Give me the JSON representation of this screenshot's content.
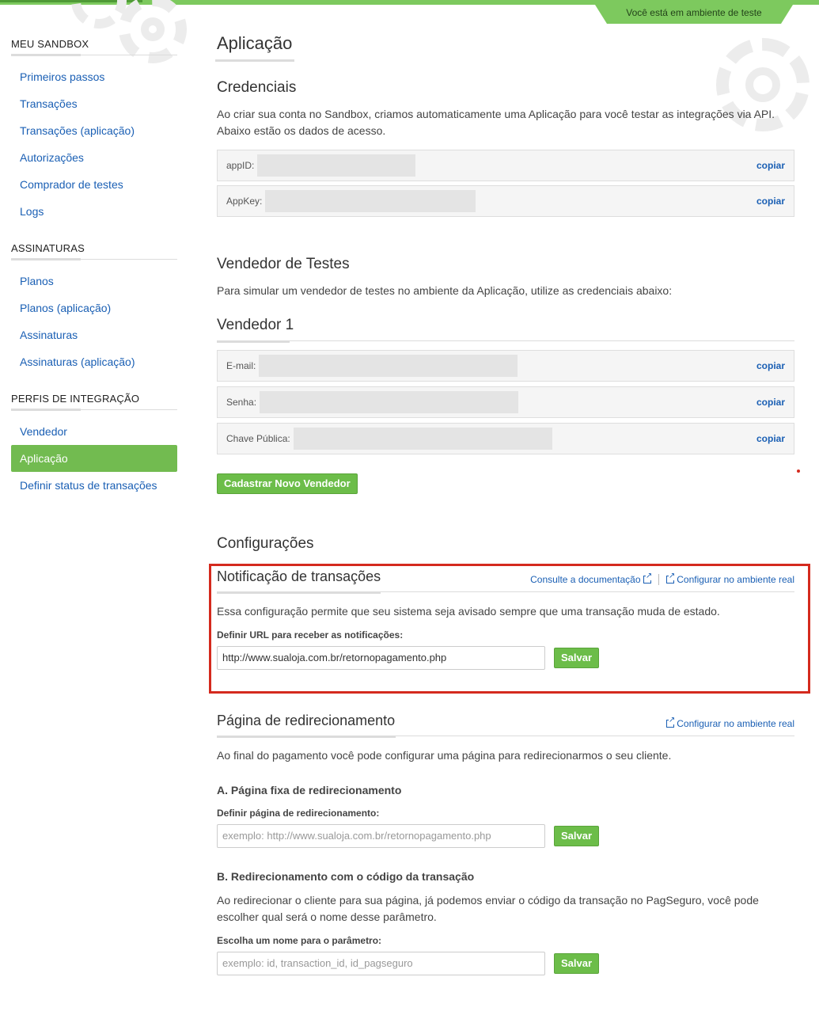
{
  "env_badge": "Você está em ambiente de teste",
  "sidebar": {
    "sections": [
      {
        "heading": "MEU SANDBOX",
        "items": [
          "Primeiros passos",
          "Transações",
          "Transações (aplicação)",
          "Autorizações",
          "Comprador de testes",
          "Logs"
        ]
      },
      {
        "heading": "ASSINATURAS",
        "items": [
          "Planos",
          "Planos (aplicação)",
          "Assinaturas",
          "Assinaturas (aplicação)"
        ]
      },
      {
        "heading": "PERFIS DE INTEGRAÇÃO",
        "items": [
          "Vendedor",
          "Aplicação",
          "Definir status de transações"
        ]
      }
    ],
    "active_item": "Aplicação"
  },
  "main": {
    "title": "Aplicação",
    "credentials": {
      "heading": "Credenciais",
      "description": "Ao criar sua conta no Sandbox, criamos automaticamente uma Aplicação para você testar as integrações via API. Abaixo estão os dados de acesso.",
      "rows": [
        {
          "label": "appID:",
          "action": "copiar"
        },
        {
          "label": "AppKey:",
          "action": "copiar"
        }
      ]
    },
    "test_seller": {
      "heading": "Vendedor de Testes",
      "description": "Para simular um vendedor de testes no ambiente da Aplicação, utilize as credenciais abaixo:",
      "seller_heading": "Vendedor 1",
      "rows": [
        {
          "label": "E-mail:",
          "action": "copiar"
        },
        {
          "label": "Senha:",
          "action": "copiar"
        },
        {
          "label": "Chave Pública:",
          "action": "copiar"
        }
      ],
      "new_seller_button": "Cadastrar Novo Vendedor"
    },
    "settings": {
      "heading": "Configurações",
      "notification": {
        "heading": "Notificação de transações",
        "doc_link": "Consulte a documentação",
        "real_env_link": "Configurar no ambiente real",
        "description": "Essa configuração permite que seu sistema seja avisado sempre que uma transação muda de estado.",
        "field_label": "Definir URL para receber as notificações:",
        "field_value": "http://www.sualoja.com.br/retornopagamento.php",
        "save_label": "Salvar"
      },
      "redirect": {
        "heading": "Página de redirecionamento",
        "real_env_link": "Configurar no ambiente real",
        "description": "Ao final do pagamento você pode configurar uma página para redirecionarmos o seu cliente.",
        "fixed": {
          "heading": "A. Página fixa de redirecionamento",
          "field_label": "Definir página de redirecionamento:",
          "placeholder": "exemplo: http://www.sualoja.com.br/retornopagamento.php",
          "save_label": "Salvar"
        },
        "code": {
          "heading": "B. Redirecionamento com o código da transação",
          "description": "Ao redirecionar o cliente para sua página, já podemos enviar o código da transação no PagSeguro, você pode escolher qual será o nome desse parâmetro.",
          "field_label": "Escolha um nome para o parâmetro:",
          "placeholder": "exemplo: id, transaction_id, id_pagseguro",
          "save_label": "Salvar"
        }
      }
    }
  }
}
